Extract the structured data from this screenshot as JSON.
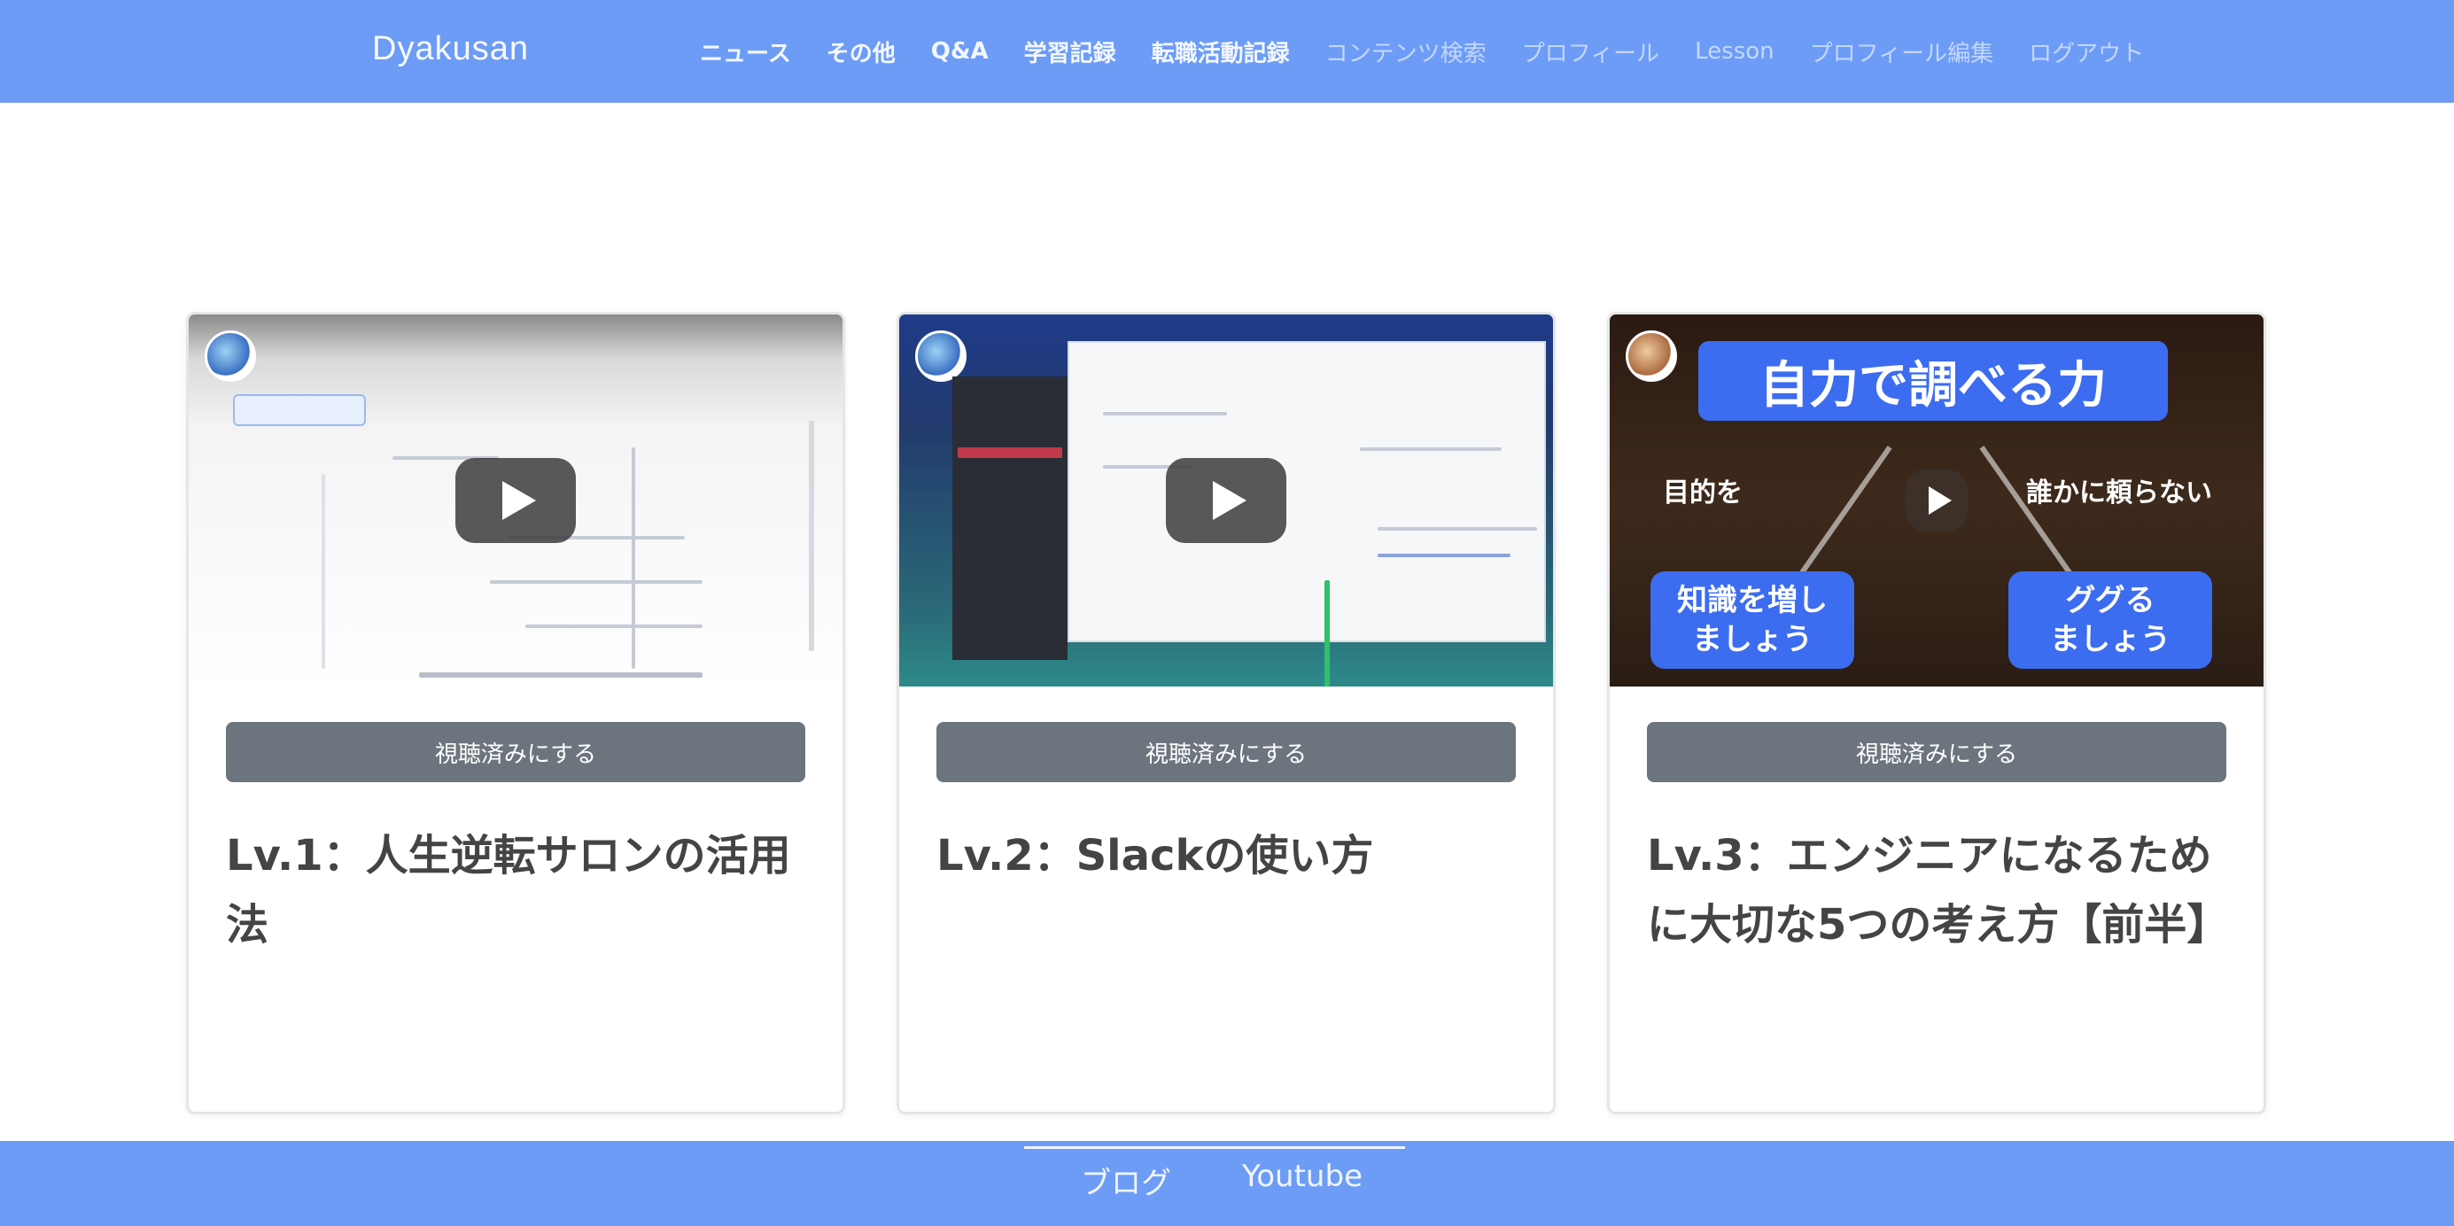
{
  "header": {
    "logo": "Dyakusan",
    "nav": [
      {
        "label": "ニュース",
        "weight": "bold"
      },
      {
        "label": "その他",
        "weight": "bold"
      },
      {
        "label": "Q&A",
        "weight": "bold"
      },
      {
        "label": "学習記録",
        "weight": "bold"
      },
      {
        "label": "転職活動記録",
        "weight": "bold"
      },
      {
        "label": "コンテンツ検索",
        "weight": "light"
      },
      {
        "label": "プロフィール",
        "weight": "light"
      },
      {
        "label": "Lesson",
        "weight": "light"
      },
      {
        "label": "プロフィール編集",
        "weight": "light"
      },
      {
        "label": "ログアウト",
        "weight": "light"
      }
    ]
  },
  "cards": [
    {
      "done_label": "視聴済みにする",
      "title": "Lv.1：人生逆転サロンの活用法"
    },
    {
      "done_label": "視聴済みにする",
      "title": "Lv.2：Slackの使い方"
    },
    {
      "done_label": "視聴済みにする",
      "title": "Lv.3：エンジニアになるために大切な5つの考え方【前半】",
      "thumb": {
        "banner": "自力で調べる力",
        "left_caption": "目的を",
        "right_caption": "誰かに頼らない",
        "left_badge": "知識を増し\nましょう",
        "right_badge": "ググる\nましょう"
      }
    }
  ],
  "footer": {
    "links": [
      "ブログ",
      "Youtube"
    ]
  },
  "colors": {
    "primary": "#6d9cf6",
    "button": "#6c757d",
    "accent_blue": "#3c6cf0"
  }
}
